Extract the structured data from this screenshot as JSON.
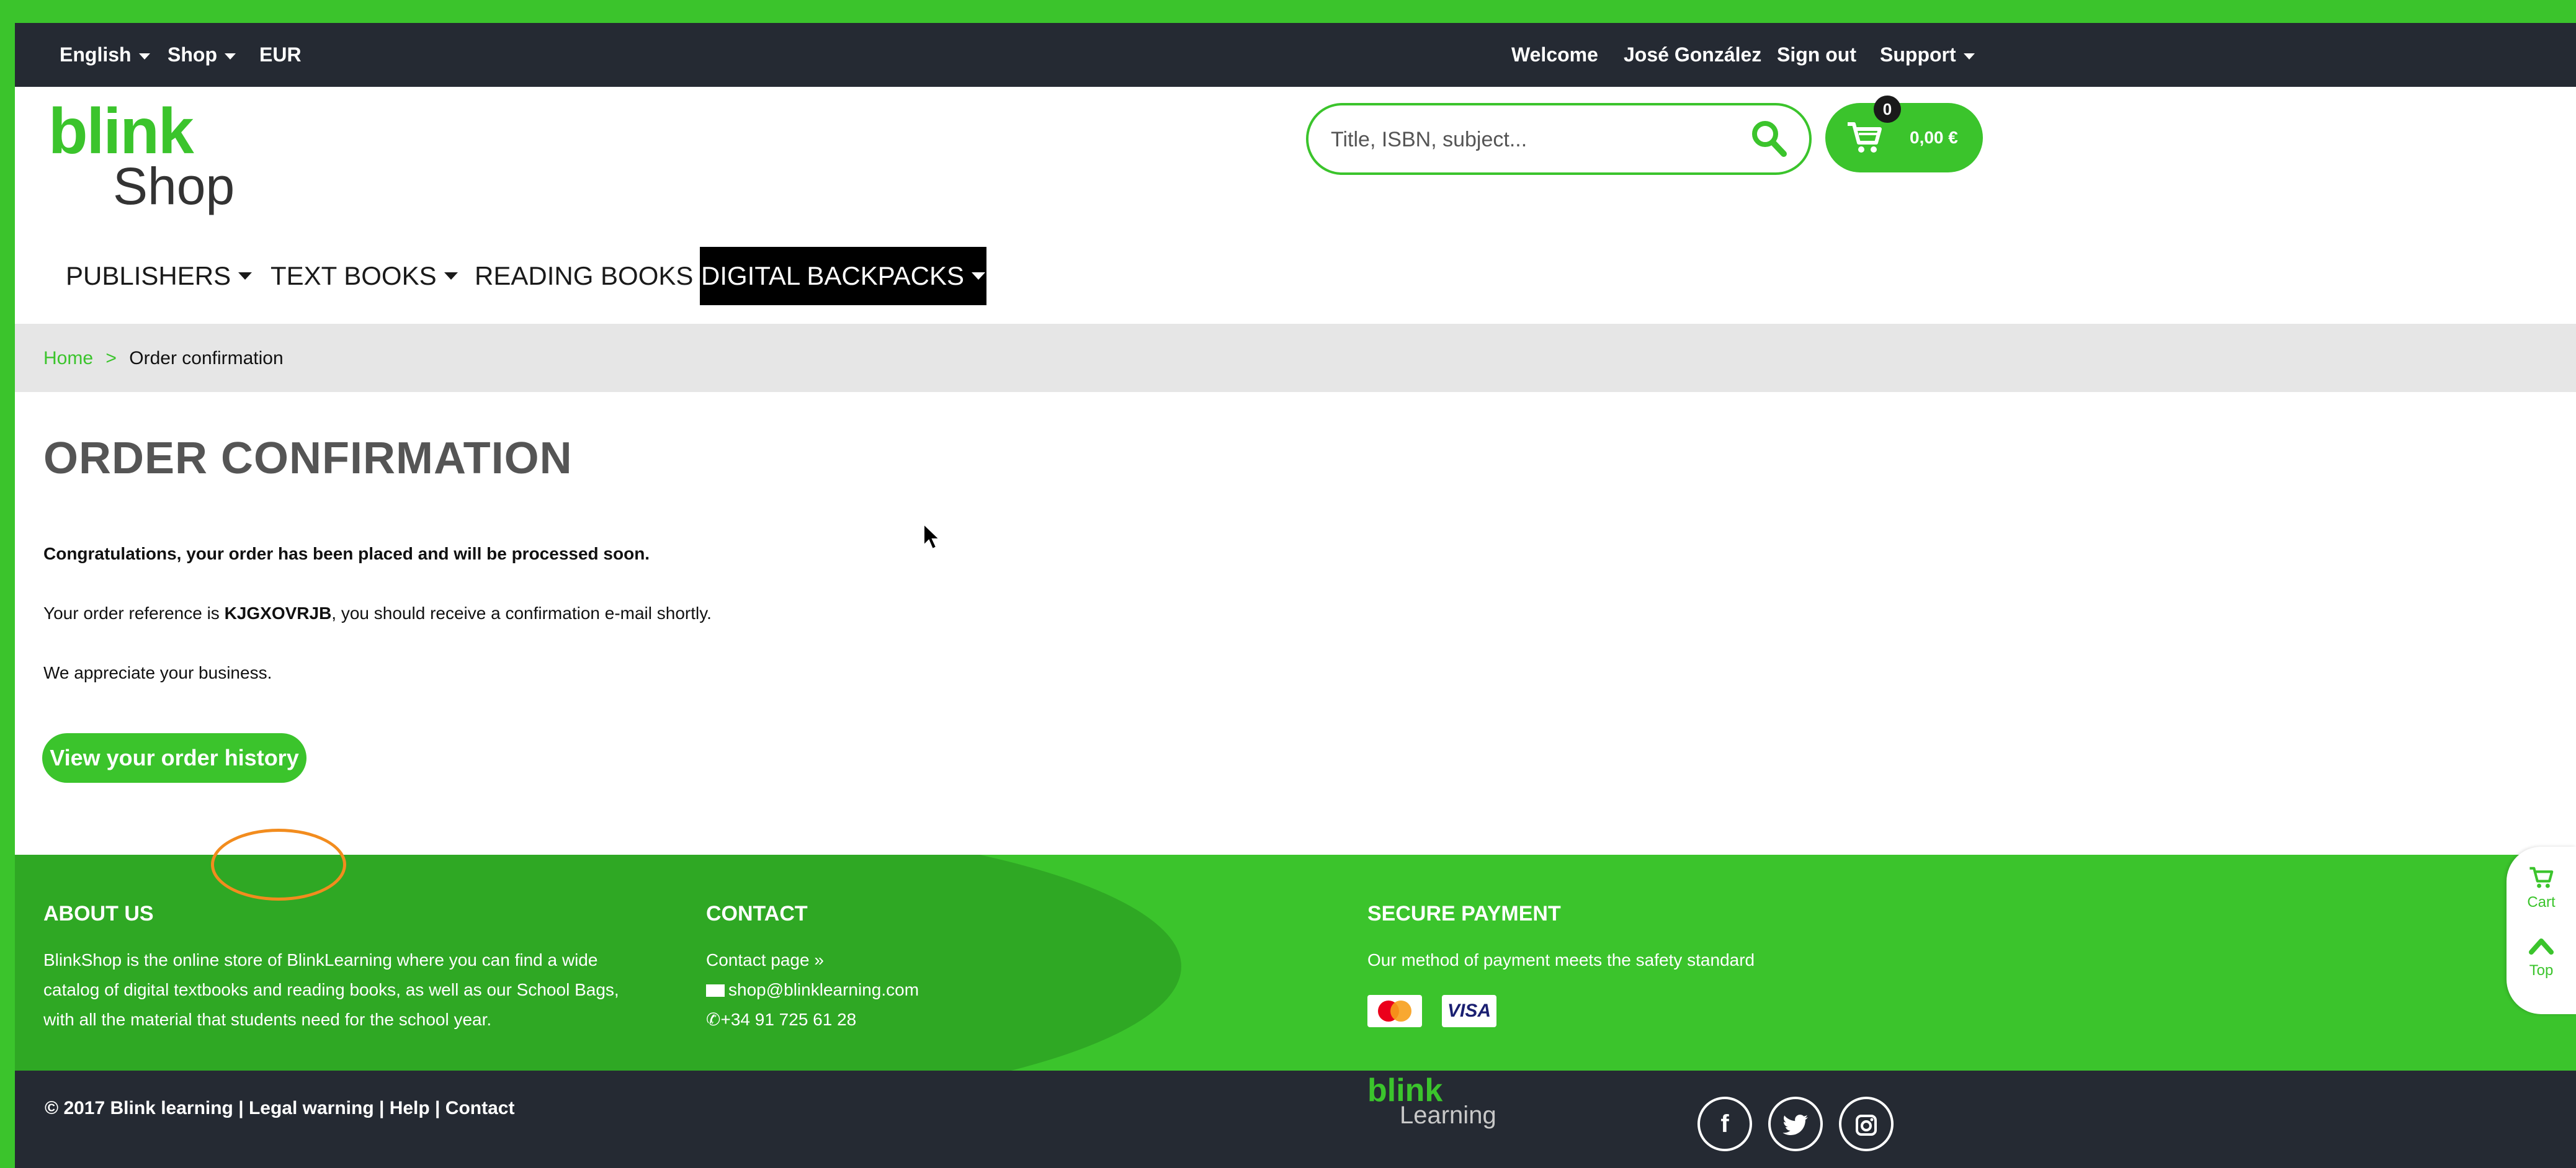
{
  "topbar": {
    "language": "English",
    "shop": "Shop",
    "currency": "EUR",
    "welcome": "Welcome",
    "user_name": "José González",
    "sign_out": "Sign out",
    "support": "Support"
  },
  "header": {
    "logo_main": "blink",
    "logo_sub": "Shop",
    "search_placeholder": "Title, ISBN, subject...",
    "cart_count": "0",
    "cart_total": "0,00 €"
  },
  "nav": {
    "items": [
      "PUBLISHERS",
      "TEXT BOOKS",
      "READING BOOKS",
      "DIGITAL BACKPACKS"
    ]
  },
  "breadcrumb": {
    "home": "Home",
    "separator": ">",
    "current": "Order confirmation"
  },
  "main": {
    "title": "ORDER CONFIRMATION",
    "congrats": "Congratulations, your order has been placed and will be processed soon.",
    "reference_prefix": "Your order reference is ",
    "reference_code": "KJGXOVRJB",
    "reference_suffix": ", you should receive a confirmation e-mail shortly.",
    "appreciate": "We appreciate your business.",
    "history_button": "View your order history"
  },
  "footer": {
    "about_title": "ABOUT US",
    "about_lines": [
      "BlinkShop is the online store of BlinkLearning where you can find a wide",
      "catalog of digital textbooks and reading books, as well as our School Bags,",
      "with all the material that students need for the school year."
    ],
    "contact_title": "CONTACT",
    "contact_page": "Contact page »",
    "contact_email": "shop@blinklearning.com",
    "contact_phone": "+34 91 725 61 28",
    "payment_title": "SECURE PAYMENT",
    "payment_text": "Our method of payment meets the safety standard",
    "card_visa": "VISA"
  },
  "bottom": {
    "copyright": "© 2017 Blink learning | Legal warning | Help | Contact",
    "logo_main": "blink",
    "logo_sub": "Learning"
  },
  "side": {
    "cart": "Cart",
    "top": "Top"
  },
  "colors": {
    "brand_green": "#3bc42c",
    "dark_bar": "#252a33",
    "annotation": "#f28c1e"
  }
}
